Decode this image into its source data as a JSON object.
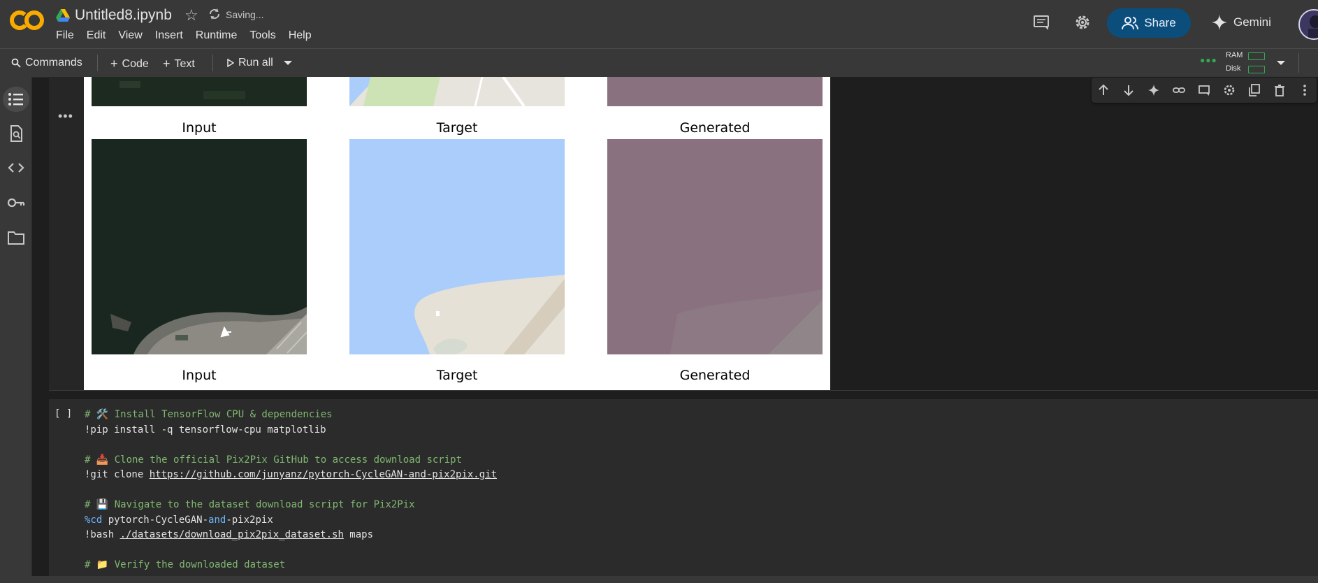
{
  "header": {
    "title": "Untitled8.ipynb",
    "status": "Saving...",
    "menu": [
      "File",
      "Edit",
      "View",
      "Insert",
      "Runtime",
      "Tools",
      "Help"
    ],
    "share_label": "Share",
    "gemini_label": "Gemini"
  },
  "toolbar": {
    "commands_label": "Commands",
    "code_label": "Code",
    "text_label": "Text",
    "run_all_label": "Run all",
    "ram_label": "RAM",
    "disk_label": "Disk"
  },
  "output": {
    "captions_top": [
      "Input",
      "Target",
      "Generated"
    ],
    "captions_bottom": [
      "Input",
      "Target",
      "Generated"
    ]
  },
  "code_cell": {
    "run_bracket": "[ ]",
    "lines": {
      "l1_comment": "# 🛠️ Install TensorFlow CPU & dependencies",
      "l2": "!pip install -q tensorflow-cpu matplotlib",
      "l4_comment": "# 📥 Clone the official Pix2Pix GitHub to access download script",
      "l5_prefix": "!git clone ",
      "l5_url": "https://github.com/junyanz/pytorch-CycleGAN-and-pix2pix.git",
      "l7_comment": "# 💾 Navigate to the dataset download script for Pix2Pix",
      "l8_magic": "%cd",
      "l8_a": " pytorch-CycleGAN-",
      "l8_kw": "and",
      "l8_b": "-pix2pix",
      "l9_prefix": "!bash ",
      "l9_path": "./datasets/download_pix2pix_dataset.sh",
      "l9_suffix": " maps",
      "l11_comment": "# 📁 Verify the downloaded dataset"
    }
  },
  "colors": {
    "share_bg": "#0b4e7c",
    "comment": "#7fb870",
    "magic": "#6cb6ff",
    "resource_ok": "#34a853",
    "map_water": "#abcdfb",
    "generated_tint": "#8a717f"
  }
}
